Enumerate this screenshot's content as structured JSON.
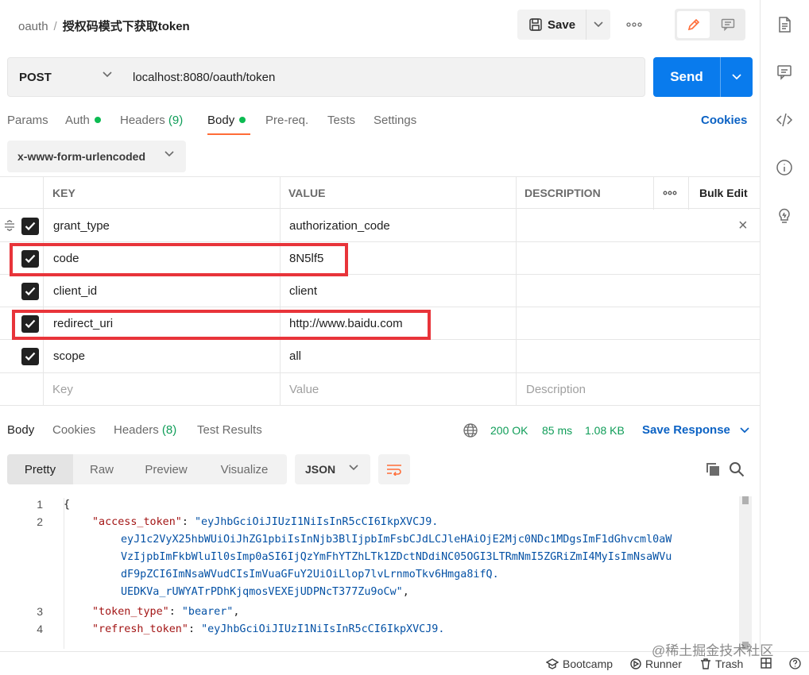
{
  "header": {
    "breadcrumb_parent": "oauth",
    "breadcrumb_sep": "/",
    "title": "授权码模式下获取token",
    "save_label": "Save",
    "more_label": "ooo"
  },
  "request": {
    "method": "POST",
    "url": "localhost:8080/oauth/token",
    "send_label": "Send"
  },
  "tabs": {
    "params": "Params",
    "auth": "Auth",
    "headers": "Headers",
    "headers_count": "(9)",
    "body": "Body",
    "prereq": "Pre-req.",
    "tests": "Tests",
    "settings": "Settings",
    "cookies": "Cookies"
  },
  "body_type": "x-www-form-urlencoded",
  "params_table": {
    "col_key": "KEY",
    "col_value": "VALUE",
    "col_description": "DESCRIPTION",
    "more": "ooo",
    "bulk_edit": "Bulk Edit",
    "rows": [
      {
        "key": "grant_type",
        "value": "authorization_code"
      },
      {
        "key": "code",
        "value": "8N5lf5"
      },
      {
        "key": "client_id",
        "value": "client"
      },
      {
        "key": "redirect_uri",
        "value": "http://www.baidu.com"
      },
      {
        "key": "scope",
        "value": "all"
      }
    ],
    "placeholder_key": "Key",
    "placeholder_value": "Value",
    "placeholder_description": "Description",
    "delete_glyph": "×"
  },
  "response": {
    "tabs": {
      "body": "Body",
      "cookies": "Cookies",
      "headers": "Headers",
      "headers_count": "(8)",
      "test_results": "Test Results"
    },
    "status": "200 OK",
    "time": "85 ms",
    "size": "1.08 KB",
    "save_response": "Save Response",
    "views": {
      "pretty": "Pretty",
      "raw": "Raw",
      "preview": "Preview",
      "visualize": "Visualize"
    },
    "format": "JSON",
    "code": {
      "line_numbers": [
        "1",
        "2",
        "3",
        "4"
      ],
      "open_brace": "{",
      "access_token_key": "\"access_token\"",
      "access_token_lines": [
        "\"eyJhbGciOiJIUzI1NiIsInR5cCI6IkpXVCJ9.",
        "eyJ1c2VyX25hbWUiOiJhZG1pbiIsInNjb3BlIjpbImFsbCJdLCJleHAiOjE2Mjc0NDc1MDgsImF1dGhvcml0aW",
        "VzIjpbImFkbWluIl0sImp0aSI6IjQzYmFhYTZhLTk1ZDctNDdiNC05OGI3LTRmNmI5ZGRiZmI4MyIsImNsaWVu",
        "dF9pZCI6ImNsaWVudCIsImVuaGFuY2UiOiLlop7lvLrnmoTkv6Hmga8ifQ.",
        "UEDKVa_rUWYATrPDhKjqmosVEXEjUDPNcT377Zu9oCw\""
      ],
      "token_type_key": "\"token_type\"",
      "token_type_value": "\"bearer\"",
      "refresh_token_key": "\"refresh_token\"",
      "refresh_token_value": "\"eyJhbGciOiJIUzI1NiIsInR5cCI6IkpXVCJ9."
    }
  },
  "footer": {
    "bootcamp": "Bootcamp",
    "runner": "Runner",
    "trash": "Trash"
  },
  "watermark": "@稀土掘金技术社区",
  "colors": {
    "accent_orange": "#ff6c37",
    "send_blue": "#097bed",
    "link_blue": "#0b62c4",
    "status_green": "#0f9d58",
    "highlight_red": "#e8343a"
  }
}
